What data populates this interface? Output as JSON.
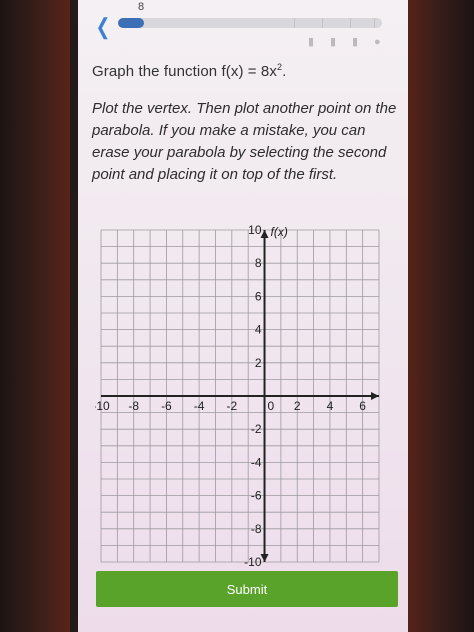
{
  "progress": {
    "count": "8",
    "fraction": 0.1
  },
  "question": {
    "prefix": "Graph the function ",
    "fx": "f(x) = 8x",
    "exponent": "2",
    "suffix": "."
  },
  "instructions": "Plot the vertex. Then plot another point on the parabola. If you make a mistake, you can erase your parabola by selecting the second point and placing it on top of the first.",
  "graph": {
    "y_axis_label": "f(x)",
    "x_tick_labels": [
      "-10",
      "-8",
      "-6",
      "-4",
      "-2",
      "0",
      "2",
      "4",
      "6"
    ],
    "y_tick_labels": [
      "10",
      "8",
      "6",
      "4",
      "2",
      "-2",
      "-4",
      "-6",
      "-8",
      "-10"
    ],
    "x_range": [
      -10,
      6
    ],
    "y_range": [
      -10,
      10
    ],
    "grid": true
  },
  "submit": {
    "label": "Submit"
  },
  "colors": {
    "accent": "#3d6fb6",
    "submit": "#5aa32b"
  }
}
